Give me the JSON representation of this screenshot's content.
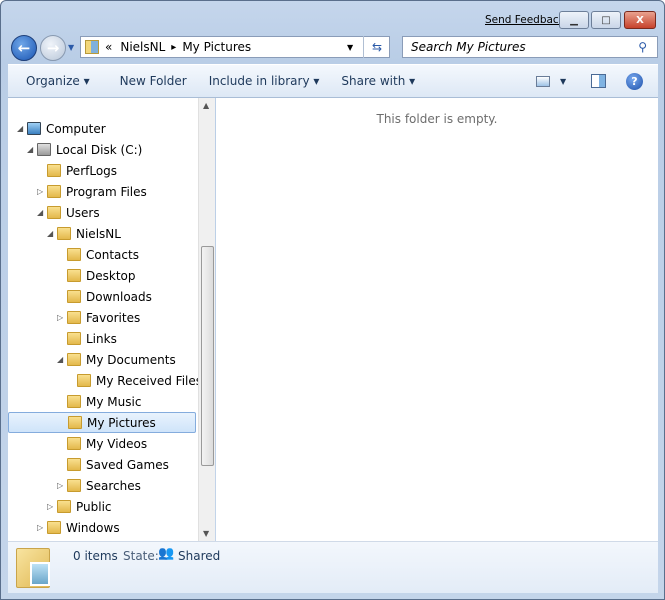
{
  "titlebar": {
    "send_feedback": "Send Feedback",
    "minimize": "▁",
    "maximize": "□",
    "close": "X"
  },
  "address": {
    "overflow": "«",
    "crumbs": [
      "NielsNL",
      "My Pictures"
    ],
    "separator": "▸"
  },
  "search": {
    "placeholder": "Search My Pictures"
  },
  "toolbar": {
    "organize": "Organize ▾",
    "new_folder": "New Folder",
    "include": "Include in library ▾",
    "share": "Share with ▾"
  },
  "tree": [
    {
      "label": "Computer",
      "level": 0,
      "state": "expanded",
      "icon": "computer"
    },
    {
      "label": "Local Disk (C:)",
      "level": 1,
      "state": "expanded",
      "icon": "drive"
    },
    {
      "label": "PerfLogs",
      "level": 2,
      "state": "none",
      "icon": "folder"
    },
    {
      "label": "Program Files",
      "level": 2,
      "state": "collapsed",
      "icon": "folder"
    },
    {
      "label": "Users",
      "level": 2,
      "state": "expanded",
      "icon": "folder"
    },
    {
      "label": "NielsNL",
      "level": 3,
      "state": "expanded",
      "icon": "folder"
    },
    {
      "label": "Contacts",
      "level": 4,
      "state": "none",
      "icon": "folder"
    },
    {
      "label": "Desktop",
      "level": 4,
      "state": "none",
      "icon": "folder"
    },
    {
      "label": "Downloads",
      "level": 4,
      "state": "none",
      "icon": "folder"
    },
    {
      "label": "Favorites",
      "level": 4,
      "state": "collapsed",
      "icon": "folder"
    },
    {
      "label": "Links",
      "level": 4,
      "state": "none",
      "icon": "folder"
    },
    {
      "label": "My Documents",
      "level": 4,
      "state": "expanded",
      "icon": "folder"
    },
    {
      "label": "My Received Files",
      "level": 5,
      "state": "none",
      "icon": "folder"
    },
    {
      "label": "My Music",
      "level": 4,
      "state": "none",
      "icon": "folder"
    },
    {
      "label": "My Pictures",
      "level": 4,
      "state": "none",
      "icon": "folder",
      "selected": true
    },
    {
      "label": "My Videos",
      "level": 4,
      "state": "none",
      "icon": "folder"
    },
    {
      "label": "Saved Games",
      "level": 4,
      "state": "none",
      "icon": "folder"
    },
    {
      "label": "Searches",
      "level": 4,
      "state": "collapsed",
      "icon": "folder"
    },
    {
      "label": "Public",
      "level": 3,
      "state": "collapsed",
      "icon": "folder"
    },
    {
      "label": "Windows",
      "level": 2,
      "state": "collapsed",
      "icon": "folder"
    }
  ],
  "content": {
    "empty_message": "This folder is empty."
  },
  "details": {
    "count": "0 items",
    "state_label": "State:",
    "state_value": "Shared"
  }
}
